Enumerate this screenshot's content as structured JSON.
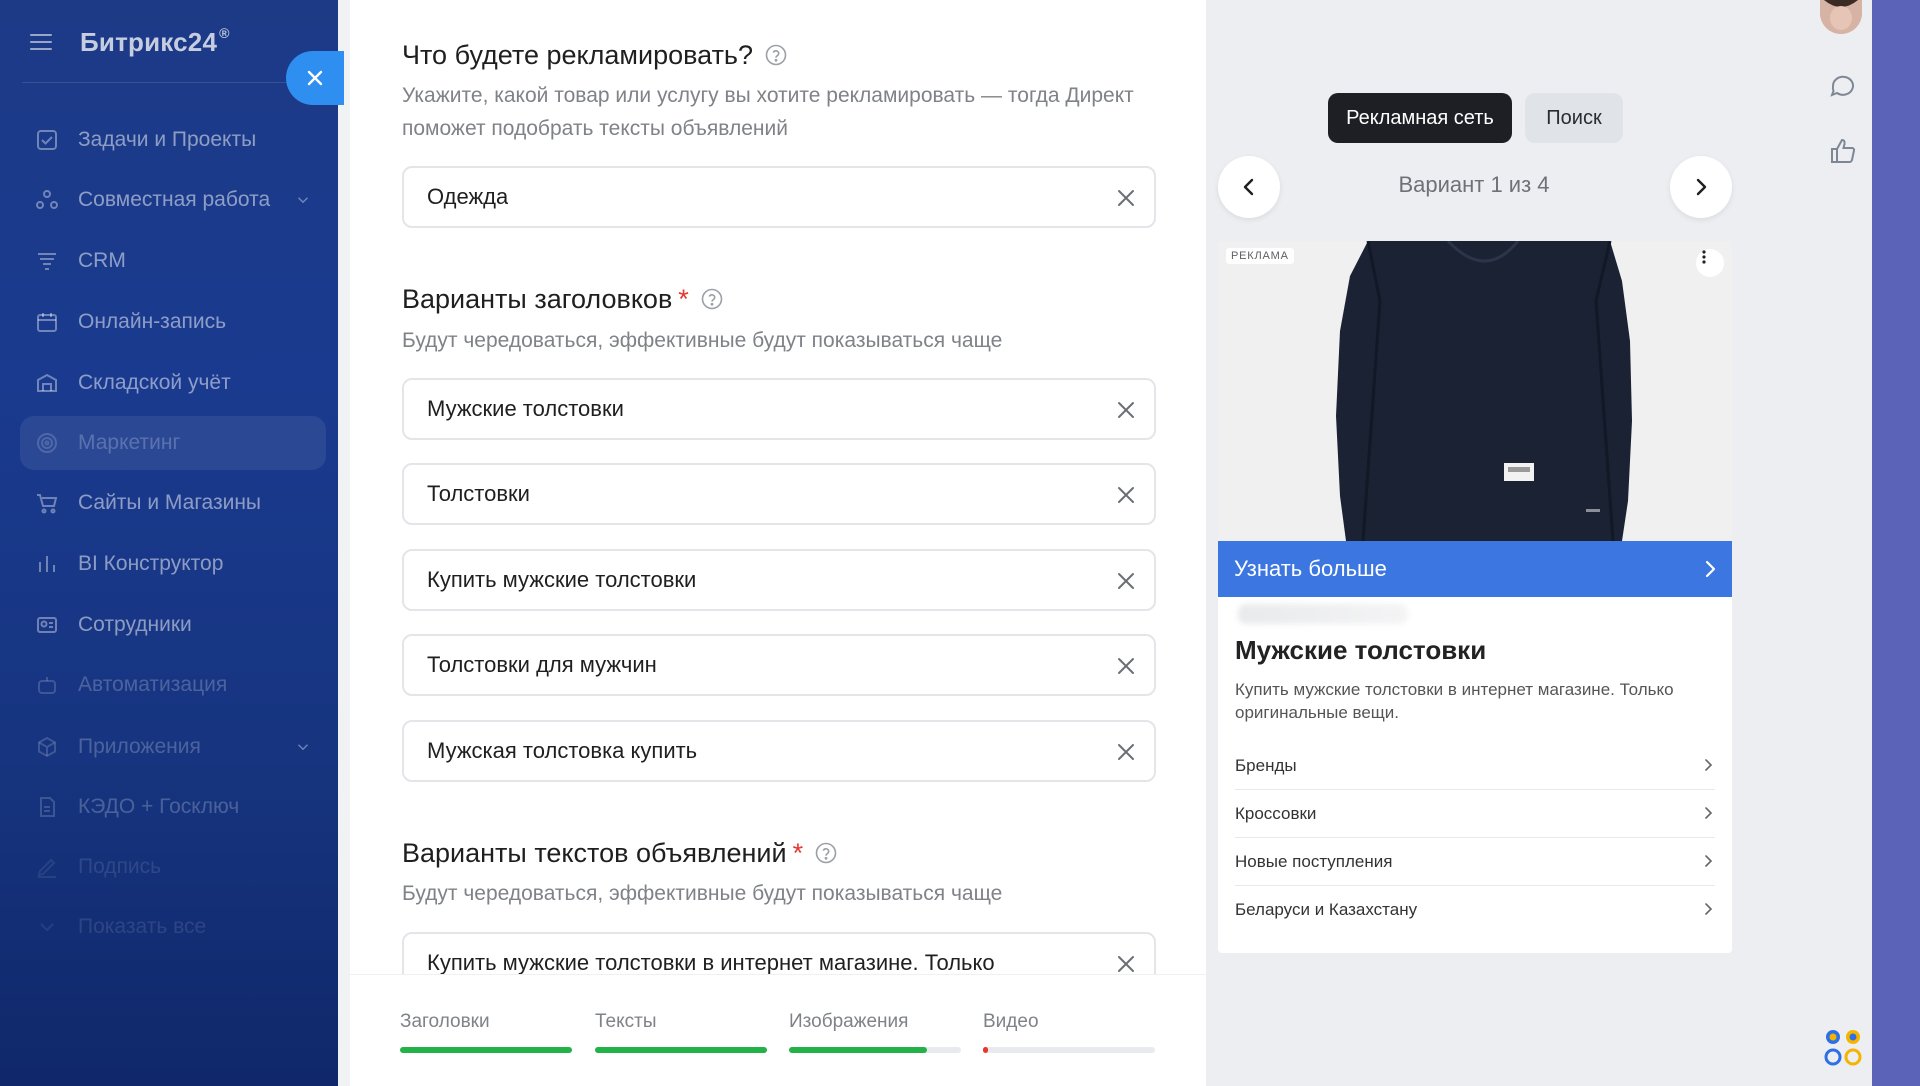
{
  "sidebar": {
    "brand": "Битрикс24",
    "brand_sup": "®",
    "items": [
      {
        "label": "Задачи и Проекты",
        "icon": "checkbox-icon"
      },
      {
        "label": "Совместная работа",
        "icon": "collaboration-icon",
        "expandable": true
      },
      {
        "label": "CRM",
        "icon": "crm-icon"
      },
      {
        "label": "Онлайн-запись",
        "icon": "calendar-icon"
      },
      {
        "label": "Складской учёт",
        "icon": "warehouse-icon"
      },
      {
        "label": "Маркетинг",
        "icon": "target-icon",
        "active": true
      },
      {
        "label": "Сайты и Магазины",
        "icon": "cart-icon"
      },
      {
        "label": "BI Конструктор",
        "icon": "bar-chart-icon"
      },
      {
        "label": "Сотрудники",
        "icon": "id-card-icon"
      },
      {
        "label": "Автоматизация",
        "icon": "robot-icon"
      },
      {
        "label": "Приложения",
        "icon": "cube-icon",
        "expandable": true
      },
      {
        "label": "КЭДО + Госключ",
        "icon": "document-icon"
      },
      {
        "label": "Подпись",
        "icon": "pen-icon"
      },
      {
        "label": "Показать все",
        "icon": "chevron-down-icon"
      }
    ]
  },
  "form": {
    "product": {
      "title": "Что будете рекламировать?",
      "description": "Укажите, какой товар или услугу вы хотите рекламировать — тогда Директ поможет подобрать тексты объявлений",
      "value": "Одежда"
    },
    "headlines": {
      "title": "Варианты заголовков",
      "required_mark": "*",
      "description": "Будут чередоваться, эффективные будут показываться чаще",
      "values": [
        "Мужские толстовки",
        "Толстовки",
        "Купить мужские толстовки",
        "Толстовки для мужчин",
        "Мужская толстовка купить"
      ]
    },
    "texts": {
      "title": "Варианты текстов объявлений",
      "required_mark": "*",
      "description": "Будут чередоваться, эффективные будут показываться чаще",
      "first_value": "Купить мужские толстовки в интернет магазине. Только"
    },
    "progress": [
      {
        "label": "Заголовки",
        "value": 1.0,
        "color": "#22b248"
      },
      {
        "label": "Тексты",
        "value": 1.0,
        "color": "#22b248"
      },
      {
        "label": "Изображения",
        "value": 0.8,
        "color": "#22b248"
      },
      {
        "label": "Видео",
        "value": 0.02,
        "color": "#e5372c"
      }
    ]
  },
  "preview": {
    "tabs": {
      "active": "Рекламная сеть",
      "inactive": "Поиск"
    },
    "variant": "Вариант 1 из 4",
    "ad": {
      "badge": "РЕКЛАМА",
      "cta": "Узнать больше",
      "title": "Мужские толстовки",
      "description": "Купить мужские толстовки в интернет магазине. Только оригинальные вещи.",
      "sitelinks": [
        "Бренды",
        "Кроссовки",
        "Новые поступления",
        "Беларуси и Казахстану"
      ]
    }
  },
  "colors": {
    "accent_blue": "#3b76e1",
    "close_blue": "#2f8ff0",
    "progress_green": "#22b248",
    "required_red": "#e5372c",
    "dark_tab": "#1d1f24"
  }
}
